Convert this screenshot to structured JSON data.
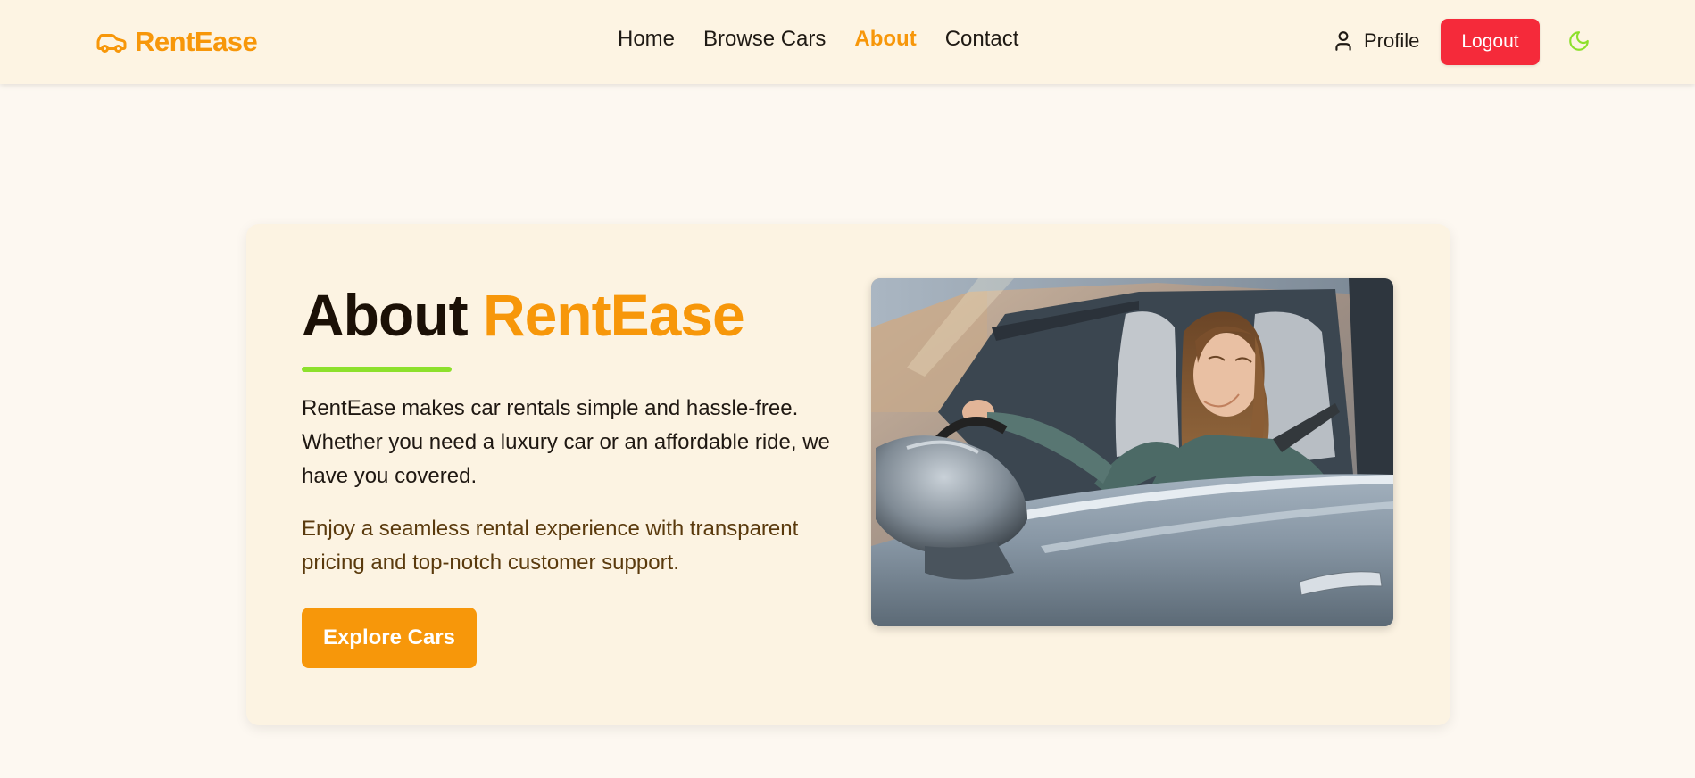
{
  "brand": {
    "name": "RentEase",
    "icon": "car-icon",
    "color": "#f7970a"
  },
  "nav": {
    "links": [
      {
        "label": "Home",
        "active": false
      },
      {
        "label": "Browse Cars",
        "active": false
      },
      {
        "label": "About",
        "active": true
      },
      {
        "label": "Contact",
        "active": false
      }
    ],
    "profile": {
      "label": "Profile",
      "icon": "user-icon"
    },
    "logout_label": "Logout",
    "theme_toggle_icon": "moon-icon"
  },
  "about": {
    "title_prefix": "About",
    "title_accent": "RentEase",
    "paragraph_1": "RentEase makes car rentals simple and hassle-free. Whether you need a luxury car or an affordable ride, we have you covered.",
    "paragraph_2": "Enjoy a seamless rental experience with transparent pricing and top-notch customer support.",
    "cta_label": "Explore Cars"
  },
  "colors": {
    "accent": "#f7970a",
    "logout": "#f52a3a",
    "underline": "#8de02c",
    "background": "#fdf8f1",
    "card": "#fcf3e2",
    "header": "#fdf4e3"
  }
}
